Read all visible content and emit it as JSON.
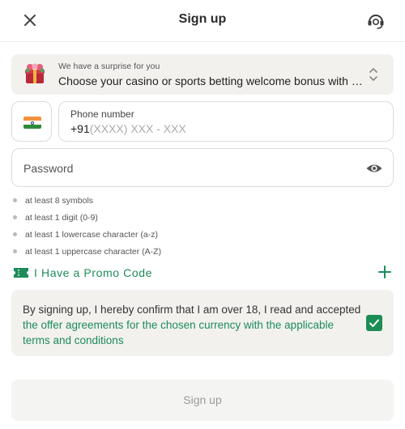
{
  "header": {
    "title": "Sign up",
    "close_icon": "close-icon",
    "support_icon": "headset-icon"
  },
  "bonus": {
    "label": "We have a surprise for you",
    "value": "Choose your casino or sports betting welcome bonus with y...",
    "icon": "gift-icon"
  },
  "phone": {
    "country_flag": "india-flag",
    "label": "Phone number",
    "code": "+91",
    "placeholder": "(XXXX) XXX - XXX"
  },
  "password": {
    "placeholder": "Password",
    "icon": "eye-icon"
  },
  "rules": [
    "at least 8 symbols",
    "at least 1 digit (0-9)",
    "at least 1 lowercase character (a-z)",
    "at least 1 uppercase character (A-Z)"
  ],
  "promo": {
    "label": "I Have a Promo Code",
    "icon": "ticket-icon"
  },
  "agreement": {
    "text": "By signing up, I hereby confirm that I am over 18, I read and accepted ",
    "link": "the offer agreements for the chosen currency with the applicable terms and conditions",
    "checked": true
  },
  "submit": {
    "label": "Sign up"
  },
  "colors": {
    "accent": "#1d8b5a",
    "checkbox": "#1c8e55",
    "panel": "#f2f1ee",
    "border": "#dcdcdc"
  }
}
